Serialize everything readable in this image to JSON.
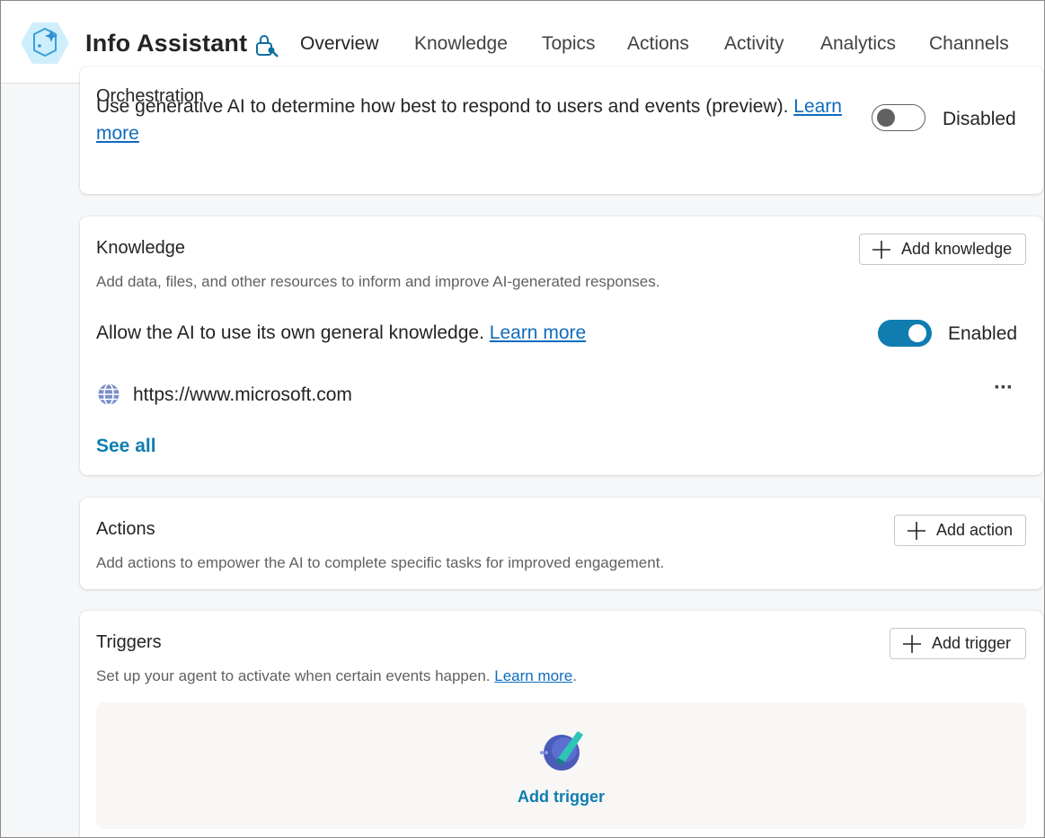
{
  "app": {
    "title": "Info Assistant"
  },
  "tabs": [
    {
      "label": "Overview",
      "active": true
    },
    {
      "label": "Knowledge",
      "active": false
    },
    {
      "label": "Topics",
      "active": false
    },
    {
      "label": "Actions",
      "active": false
    },
    {
      "label": "Activity",
      "active": false
    },
    {
      "label": "Analytics",
      "active": false
    },
    {
      "label": "Channels",
      "active": false
    }
  ],
  "orchestration": {
    "title": "Orchestration",
    "description": "Use generative AI to determine how best to respond to users and events (preview).",
    "link_word1": "Learn",
    "link_word2": "more",
    "toggle_state": "Disabled"
  },
  "knowledge": {
    "title": "Knowledge",
    "add_button": "Add knowledge",
    "description": "Add data, files, and other resources to inform and improve AI-generated responses.",
    "general_knowledge_text": "Allow the AI to use its own general knowledge.",
    "general_knowledge_link": "Learn more",
    "toggle_state": "Enabled",
    "sources": [
      {
        "url": "https://www.microsoft.com",
        "icon": "globe-icon"
      }
    ],
    "more_menu": "···",
    "see_all": "See all"
  },
  "actions": {
    "title": "Actions",
    "add_button": "Add action",
    "description": "Add actions to empower the AI to complete specific tasks for improved engagement."
  },
  "triggers": {
    "title": "Triggers",
    "add_button": "Add trigger",
    "description": "Set up your agent to activate when certain events happen.",
    "description_link": "Learn more",
    "description_end": ".",
    "empty_cta": "Add trigger"
  },
  "colors": {
    "accent": "#0f6cbd",
    "toggle_on": "#0f7db0",
    "link_teal": "#0f7db0"
  }
}
